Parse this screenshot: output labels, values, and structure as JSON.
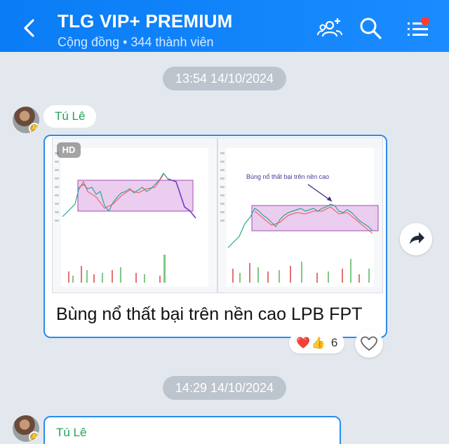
{
  "header": {
    "title": "TLG VIP+ PREMIUM",
    "subtitle": "Cộng đồng • 344 thành viên",
    "accent_color": "#1a8cff",
    "icons": [
      "back-arrow-icon",
      "group-add-icon",
      "search-icon",
      "menu-list-icon"
    ]
  },
  "messages": [
    {
      "timestamp": "13:54 14/10/2024",
      "sender": "Tú Lê",
      "hd_badge": "HD",
      "chart_annotation": "Bùng nổ thất bại trên nền cao",
      "caption": "Bùng nổ thất bại trên nền cao LPB FPT",
      "reactions": {
        "emojis": [
          "❤️",
          "👍"
        ],
        "count": "6"
      }
    },
    {
      "timestamp": "14:29 14/10/2024",
      "sender": "Tú Lê"
    }
  ]
}
